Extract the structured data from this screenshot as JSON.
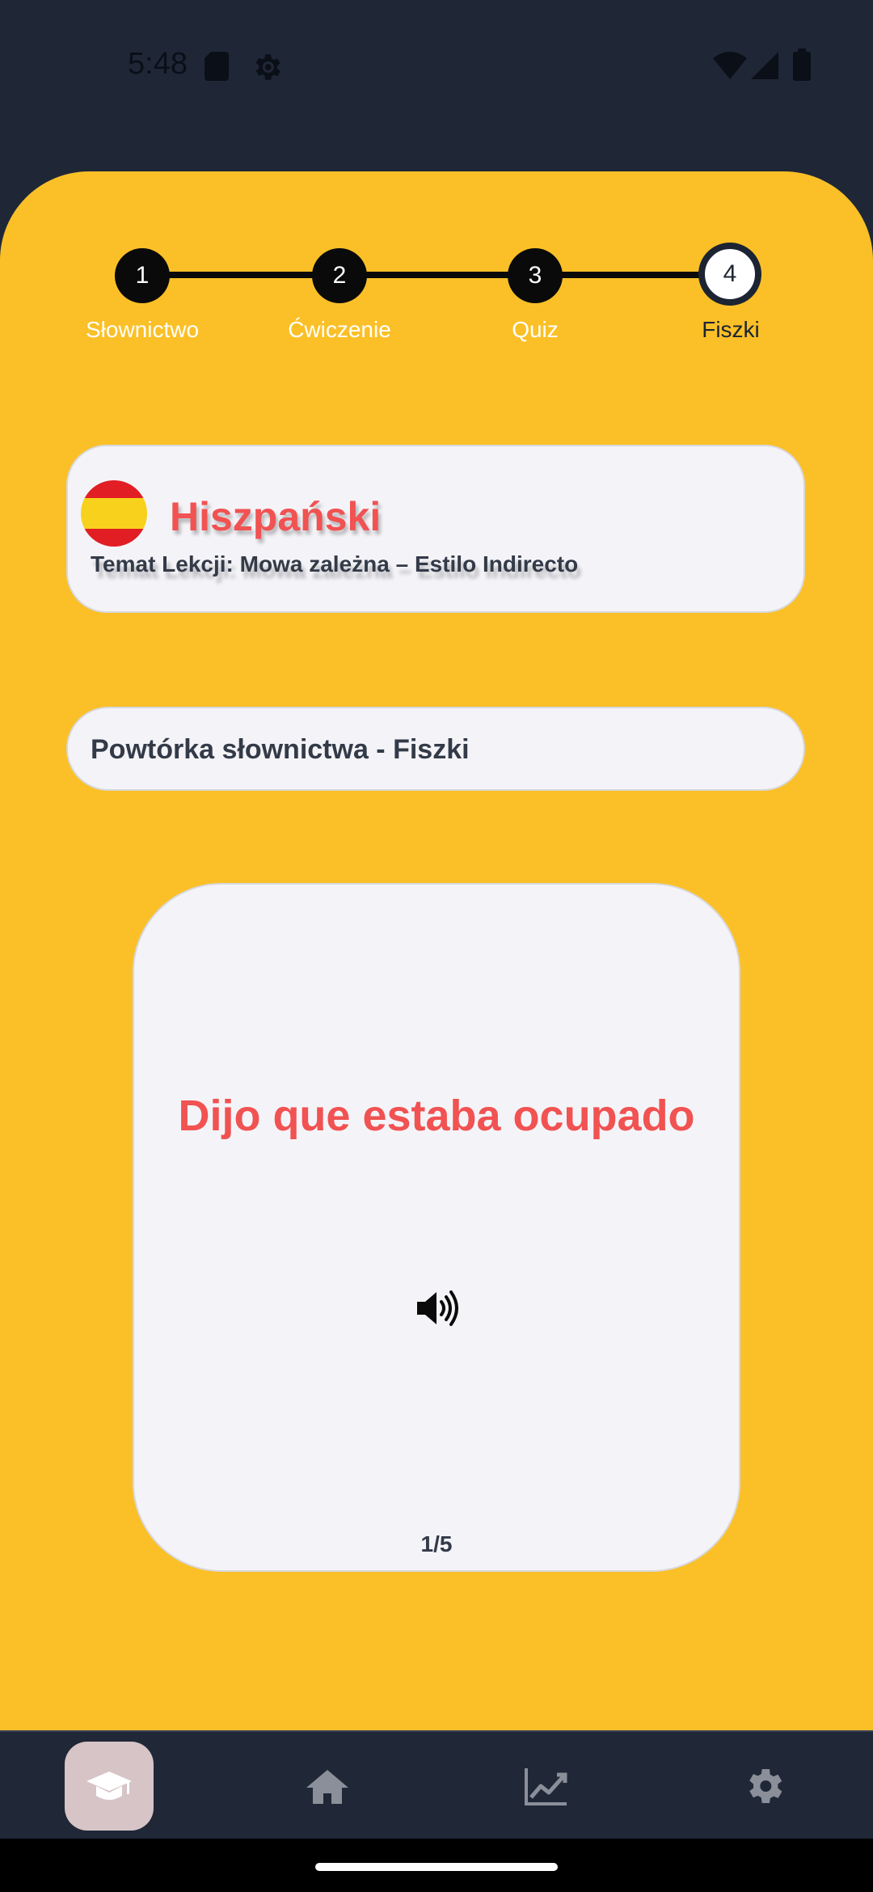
{
  "status_bar": {
    "time": "5:48"
  },
  "stepper": {
    "steps": [
      {
        "number": "1",
        "label": "Słownictwo"
      },
      {
        "number": "2",
        "label": "Ćwiczenie"
      },
      {
        "number": "3",
        "label": "Quiz"
      },
      {
        "number": "4",
        "label": "Fiszki"
      }
    ],
    "active_step": 4
  },
  "lesson": {
    "language": "Hiszpański",
    "topic": "Temat Lekcji: Mowa zależna – Estilo Indirecto",
    "flag_icon": "spain-flag-icon"
  },
  "section": {
    "title": "Powtórka słownictwa - Fiszki"
  },
  "flashcard": {
    "phrase": "Dijo que estaba ocupado",
    "counter": "1/5",
    "audio_icon": "speaker-icon"
  },
  "bottom_nav": {
    "items": [
      {
        "icon": "graduation-cap-icon",
        "active": true
      },
      {
        "icon": "home-icon",
        "active": false
      },
      {
        "icon": "chart-line-icon",
        "active": false
      },
      {
        "icon": "gear-icon",
        "active": false
      }
    ]
  },
  "colors": {
    "background_dark": "#1f2737",
    "panel_yellow": "#fbc027",
    "accent_red": "#f15252",
    "card_bg": "#f4f4f8",
    "text_dark": "#333a48",
    "nav_active_bg": "#d6c4c7"
  }
}
